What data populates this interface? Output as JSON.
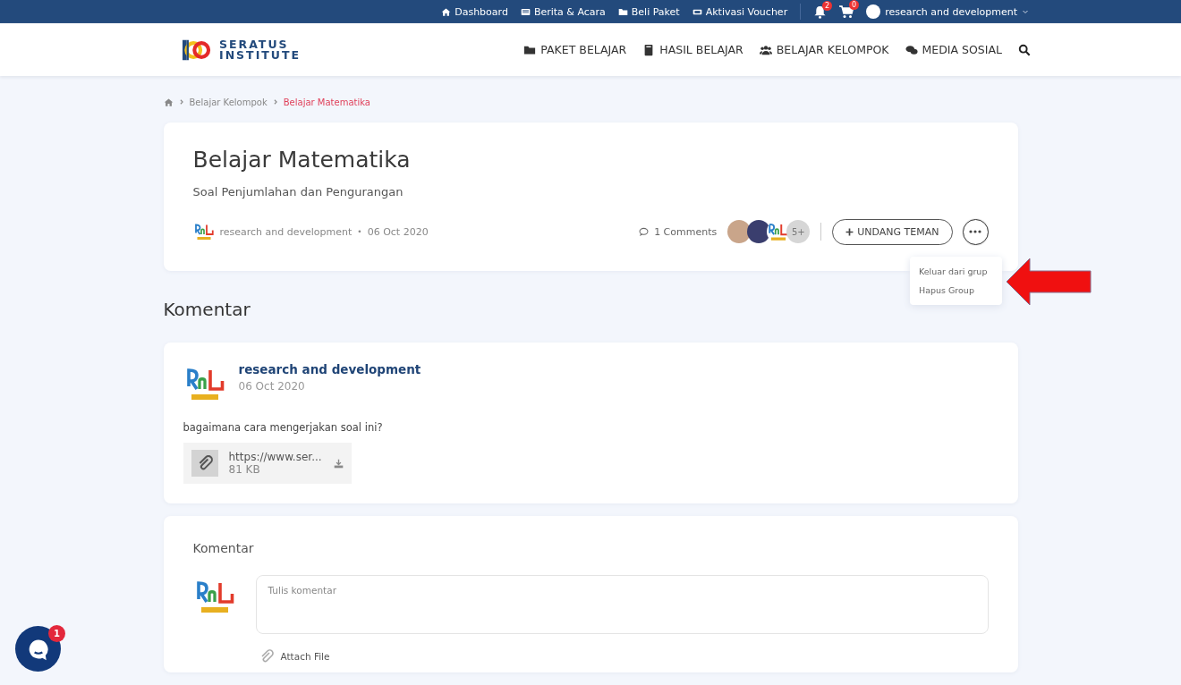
{
  "top_bar": {
    "links": [
      {
        "kind": "home",
        "label": "Dashboard"
      },
      {
        "kind": "news",
        "label": "Berita & Acara"
      },
      {
        "kind": "folder",
        "label": "Beli Paket"
      },
      {
        "kind": "ticket",
        "label": "Aktivasi Voucher"
      }
    ],
    "notifications": "2",
    "cart": "0",
    "user": "research and development"
  },
  "header": {
    "logo": [
      "SERATUS",
      "INSTITUTE"
    ],
    "nav": [
      {
        "kind": "folder",
        "label": "PAKET BELAJAR"
      },
      {
        "kind": "book",
        "label": "HASIL BELAJAR"
      },
      {
        "kind": "users",
        "label": "BELAJAR KELOMPOK"
      },
      {
        "kind": "chat",
        "label": "MEDIA SOSIAL"
      }
    ]
  },
  "breadcrumb": [
    {
      "label": "Belajar Kelompok",
      "selected": false
    },
    {
      "label": "Belajar Matematika",
      "selected": true
    }
  ],
  "group": {
    "title": "Belajar Matematika",
    "subtitle": "Soal Penjumlahan dan Pengurangan",
    "author": "research and development",
    "separator": "•",
    "date": "06 Oct 2020",
    "comments": "1 Comments",
    "members_more": "5+",
    "invite_button": "UNDANG TEMAN",
    "menu": {
      "expanded": true,
      "items": [
        {
          "label": "Keluar dari grup"
        },
        {
          "label": "Hapus Group"
        }
      ]
    }
  },
  "comments_heading": "Komentar",
  "comments": [
    {
      "author": "research and development",
      "date": "06 Oct 2020",
      "text": "bagaimana cara mengerjakan soal ini?",
      "attachment": {
        "name": "https://www.ser...",
        "size": "81 KB"
      }
    }
  ],
  "comment_form": {
    "title": "Komentar",
    "placeholder": "Tulis komentar",
    "attach": "Attach File"
  },
  "chat": {
    "badge": "1"
  }
}
